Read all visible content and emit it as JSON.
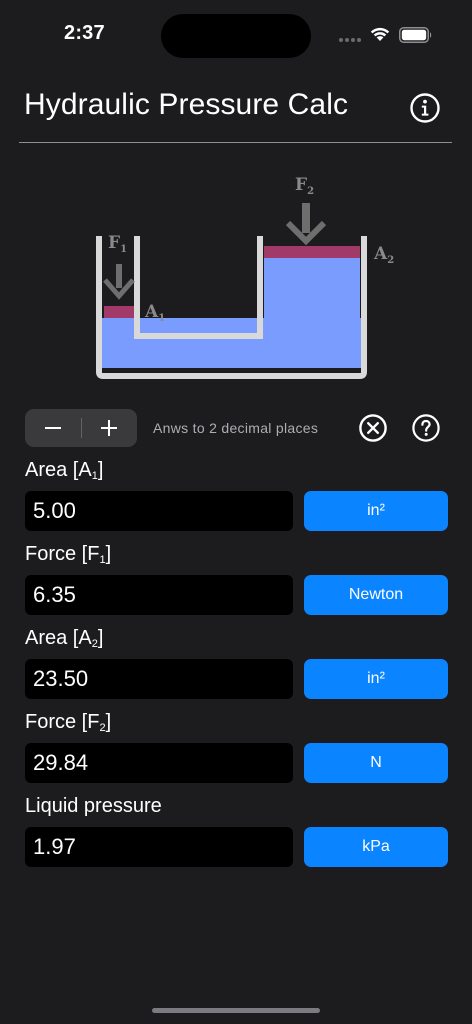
{
  "status_bar": {
    "time": "2:37"
  },
  "header": {
    "title": "Hydraulic Pressure Calc"
  },
  "diagram": {
    "labels": {
      "f1_main": "F",
      "f1_sub": "1",
      "f2_main": "F",
      "f2_sub": "2",
      "a1_main": "A",
      "a1_sub": "1",
      "a2_main": "A",
      "a2_sub": "2"
    },
    "colors": {
      "liquid": "#7b9cff",
      "piston": "#a13a68",
      "wall": "#d9d9d9",
      "arrow": "#6e6e6e"
    }
  },
  "controls": {
    "minus_label": "−",
    "plus_label": "+",
    "decimal_note": "Anws to 2 decimal places"
  },
  "fields": [
    {
      "label": "Area [A",
      "label_sub": "1",
      "label_end": "]",
      "value": "5.00",
      "unit": "in²"
    },
    {
      "label": "Force [F",
      "label_sub": "1",
      "label_end": "]",
      "value": "6.35",
      "unit": "Newton"
    },
    {
      "label": "Area [A",
      "label_sub": "2",
      "label_end": "]",
      "value": "23.50",
      "unit": "in²"
    },
    {
      "label": "Force [F",
      "label_sub": "2",
      "label_end": "]",
      "value": "29.84",
      "unit": "N"
    },
    {
      "label": "Liquid pressure",
      "label_sub": "",
      "label_end": "",
      "value": "1.97",
      "unit": "kPa"
    }
  ],
  "colors": {
    "background": "#1c1c1e",
    "accent": "#0a84ff",
    "input_bg": "#000000"
  }
}
